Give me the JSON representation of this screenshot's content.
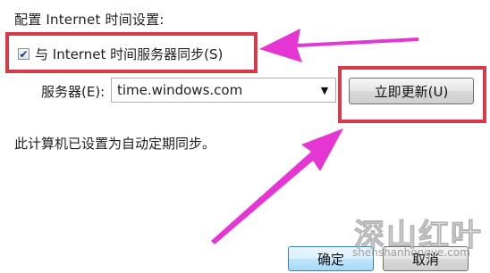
{
  "dialog": {
    "heading": "配置 Internet 时间设置:",
    "sync_checkbox": {
      "label": "与 Internet 时间服务器同步(S)",
      "checked": true,
      "glyph": "✔"
    },
    "server": {
      "label": "服务器(E):",
      "value": "time.windows.com",
      "arrow_glyph": "▼"
    },
    "update_button": "立即更新(U)",
    "status_text": "此计算机已设置为自动定期同步。",
    "ok_button": "确定",
    "cancel_button": "取消"
  },
  "annotations": {
    "highlight_color": "#d53b48",
    "arrow_color": "#e536d3"
  },
  "watermark": {
    "title": "深山红叶",
    "url": "shenshanhongye.com"
  }
}
